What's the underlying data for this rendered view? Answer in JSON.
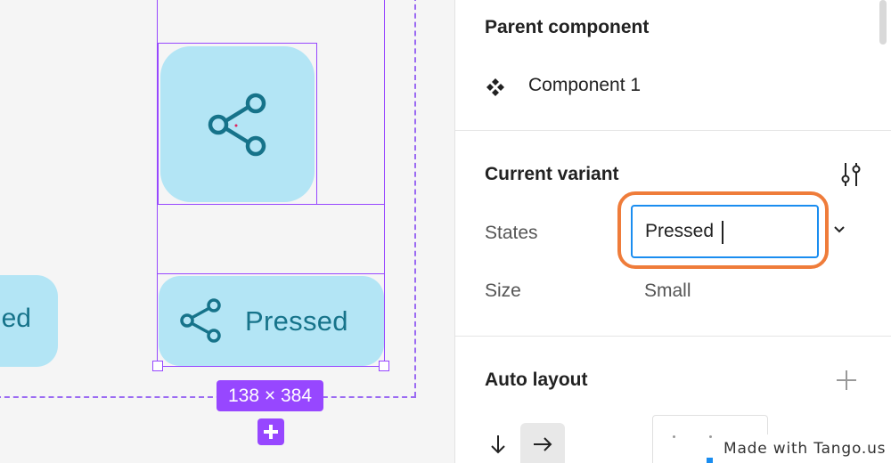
{
  "canvas": {
    "left_button_label": "ed",
    "wide_button_label": "Pressed",
    "dimension_badge": "138 × 384",
    "accent_color": "#9747ff",
    "button_fill_color": "#b3e5f5",
    "button_text_color": "#16738a"
  },
  "panel": {
    "parent_component": {
      "heading": "Parent component",
      "component_name": "Component 1"
    },
    "current_variant": {
      "heading": "Current variant",
      "properties": [
        {
          "label": "States",
          "value": "Pressed"
        },
        {
          "label": "Size",
          "value": "Small"
        }
      ]
    },
    "auto_layout": {
      "heading": "Auto layout"
    },
    "highlight_color": "#ef7c3a",
    "focus_color": "#1a8df0"
  },
  "icons": {
    "share": "share-icon",
    "component": "component-icon",
    "variant_settings": "variant-settings-icon",
    "chevron": "chevron-down-icon",
    "plus": "plus-icon",
    "arrow_down": "arrow-down-icon",
    "arrow_right": "arrow-right-icon"
  },
  "watermark": "Made with Tango.us"
}
